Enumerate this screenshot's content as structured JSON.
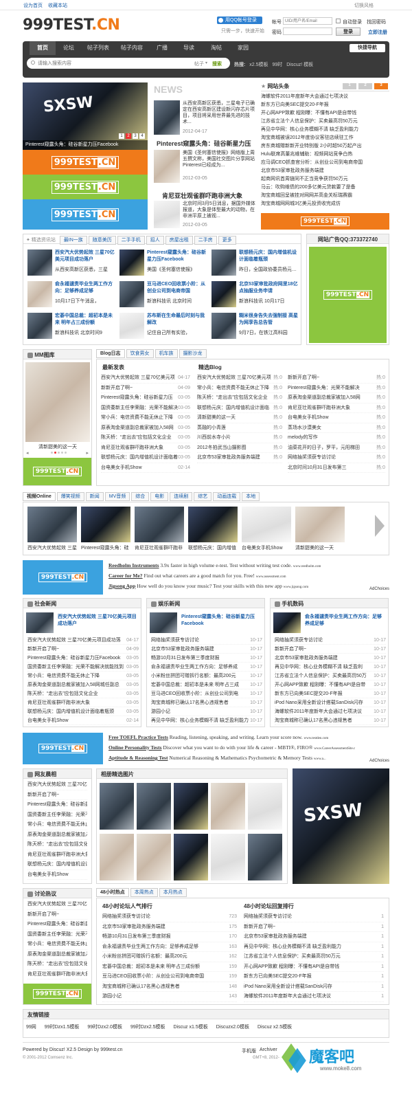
{
  "topbar": {
    "home": "设为首页",
    "fav": "收藏本站",
    "skin": "切换风格"
  },
  "logo": {
    "main": "999TEST",
    "ext": ".CN"
  },
  "qq": {
    "btn": "用QQ帐号登录",
    "sub": "只需一步，快速开始"
  },
  "login": {
    "user_label": "帐号",
    "user_ph": "UID/用户名/Email",
    "auto": "自动登录",
    "forgot": "找回密码",
    "pwd_label": "密码",
    "login_btn": "登录",
    "register": "立即注册"
  },
  "nav": [
    "首页",
    "论坛",
    "帖子列表",
    "帖子内容",
    "广播",
    "导读",
    "淘帖",
    "家园"
  ],
  "quicknav": "快捷导航",
  "search": {
    "placeholder": "请输入搜索内容",
    "scope": "帖子",
    "btn": "搜索",
    "hot_label": "热搜:",
    "hot": [
      "x2.5模板",
      "99时",
      "Discuz! 模板"
    ]
  },
  "slider": {
    "caption": "Pinterest窥露头角：硅谷新星力压Facebook",
    "pages": [
      "1",
      "2",
      "3",
      "4"
    ]
  },
  "news": {
    "label": "NEWS",
    "items": [
      {
        "intro": "从西安高新区获悉，三星电子已确定在西安高新区建设新闪存芯片项目，项目将采用世界最先进的技术...",
        "date": "2012-04-17",
        "title": "Pinterest窥露头角：硅谷新星力压"
      },
      {
        "intro": "美国《圣何塞信使报》网络版上周五撰文称，美国社交图片分享网站Pinterest已经成为...",
        "date": "2012-03-05",
        "title": "肯尼亚壮观雀群吓跑非洲大象"
      },
      {
        "intro": "北京时间3月5日消息，据国外媒体报道，大象是体型最大的动物，在非洲平原上被视...",
        "date": "2012-03-05"
      }
    ]
  },
  "headlines": {
    "title": "网站头条",
    "pages": [
      "1",
      "2",
      "3"
    ],
    "items": [
      "海螺软件2011年度新年大会通过七项决议",
      "新东方已向美SEC提交20-F年报",
      "开心网APP致歉 程刚曝：不懂有API是自带钱",
      "江苏省立法个人信息保护：买卖最高罚50万元",
      "再见中华网：核心业务模糊不清 缺乏盈利能力",
      "淘宝商城被误2012年度协议客驻店续驻工作",
      "房东商城赠新新开业特别版 2小时超50万起产出",
      "Hulu联席高董兆维辅助：视频网站竞争白热",
      "应马调CEO抓查官分析：从创业公司到电商帝国",
      "北京市53家审批政务服务端建",
      "起商网讯首周链同不正当竞争获罚50万元",
      "马云：吹购维债的200多亿美元贷款要了是备",
      "淘宝商城回呈被挂对网网并高金关标瑞赛霸",
      "淘宝商城网网城3亿美元投资收完成仿"
    ]
  },
  "tags": {
    "label": "精选资讯站",
    "items": [
      "最IN一族",
      "随意美历",
      "二手手机",
      "招人",
      "房屋出租",
      "二手房",
      "更多"
    ]
  },
  "news_grid": [
    {
      "title": "西安汽大优势起效 三星70亿美元项目成功落户",
      "desc": "从西安高新区获悉，三星"
    },
    {
      "title": "Pinterest窥露头角：硅谷新星力压Facebook",
      "desc": "美国《圣何塞信使报》"
    },
    {
      "title": "联想杨元庆：国内增值机设计面临着瓶颈",
      "desc": "昨日，全国政协委员杨元庆在"
    },
    {
      "title": "俞永福谴责毕业生两工作方向：足够养成足够",
      "desc": "10月17日下午消息，"
    },
    {
      "title": "豆马进CEO回收票小阶：从创业公司到电商帝国",
      "desc": "新浪科技讯 北京时间"
    },
    {
      "title": "北京53家审批政府网里18亿点抽服业务申请",
      "desc": "新浪科技讯 10月17日"
    },
    {
      "title": "宏碁中国总裁：超初本是未来 明年占三成份额",
      "desc": "新浪科技讯 北京时间9"
    },
    {
      "title": "苏布斯在生命最后时刻与我解改",
      "desc": "记住自己所有实验，"
    },
    {
      "title": "糊米很身告失去强制接 高星为网享告总告管",
      "desc": "9月7日，在铁江高科园"
    }
  ],
  "adqq": {
    "title": "网站广告QQ:373372740"
  },
  "mm": {
    "title": "MM图库",
    "caption": "清新甜美的这一天"
  },
  "blog": {
    "tabs": [
      "Blog日志",
      "饮食男女",
      "机车族",
      "摄影沙龙"
    ],
    "col1_title": "最新发表",
    "col2_title": "精选Blog",
    "col1": [
      [
        "西安汽大优势起效 三星70亿美元项",
        "04-17"
      ],
      [
        "新新开启了啊~",
        "04-09"
      ],
      [
        "Pinterest窥露头角：硅谷新星力压",
        "03-05"
      ],
      [
        "国资委新主任李荣融：光荣不能解决",
        "03-05"
      ],
      [
        "常小兵：电信资费不能无休止下降",
        "03-05"
      ],
      [
        "原表淘金渠道副总裁家被加入58网",
        "03-05"
      ],
      [
        "陈天桥：“走出去”应包括文化企业",
        "03-05"
      ],
      [
        "肯尼亚壮观雀群吓跑非洲大象",
        "03-05"
      ],
      [
        "联想杨元庆：国内增值机设计面临着",
        "03-05"
      ],
      [
        "台电美女手机Show",
        "02-14"
      ]
    ],
    "col2": [
      [
        "西安汽大优势起效 三星70亿美元项",
        "热:0"
      ],
      [
        "常小兵：电信资费不能无休止下降",
        "热:0"
      ],
      [
        "陈天桥：“走出去”应包括文化企业",
        "热:0"
      ],
      [
        "联想杨元庆：国内增值机设计面临",
        "热:0"
      ],
      [
        "清新甜美的这一天",
        "热:0"
      ],
      [
        "蒸融的小青莲",
        "热:0"
      ],
      [
        "川西前水寺小片",
        "热:0"
      ],
      [
        "2012冬拍武当山摄影图",
        "热:0"
      ],
      [
        "北京市53家审批政务服务端建",
        "热:0"
      ]
    ],
    "col3": [
      [
        "新新开启了啊~",
        "热:0"
      ],
      [
        "Pinterest窥露头角：光荣不能解决",
        "热:0"
      ],
      [
        "原表淘金渠道副总裁家被加入58网",
        "热:0"
      ],
      [
        "肯尼亚壮观雀群吓跑非洲大象",
        "热:0"
      ],
      [
        "台电美女手机Show",
        "热:0"
      ],
      [
        "蒸场水沙漠美女",
        "热:0"
      ],
      [
        "melody的写作",
        "热:0"
      ],
      [
        "油菜花开的日子，罗平，元阳梯田",
        "热:0"
      ],
      [
        "网络抽奖须获专访讨论",
        "热:0"
      ],
      [
        "北京时间10月31日发布第三",
        "热:0"
      ]
    ]
  },
  "video": {
    "tabs": [
      "视频Online",
      "爆笑视频",
      "新闻",
      "MV音频",
      "综合",
      "电影",
      "连续剧",
      "综艺",
      "动画连载",
      "本地"
    ],
    "items": [
      "西安汽大优势起效 三星",
      "Pinterest窥露头角：硅",
      "肯尼亚壮观雀群吓跑非",
      "联想杨元庆：国内增值",
      "台电美女手机Show",
      "清新甜美的这一天"
    ]
  },
  "textad1": [
    {
      "title": "Reedholm Instruments",
      "text": "3.9x faster in high volume e-test. Test without writing test code.",
      "url": "www.reedholm.com"
    },
    {
      "title": "Career for Me?",
      "text": "Find out what careers are a good match for you. Free!",
      "url": "www.assessment.com"
    },
    {
      "title": "Jigsong App",
      "text": "How well do you know your music? Test your skills with this new app",
      "url": "www.jigsong.com"
    }
  ],
  "adchoices": "AdChoices",
  "cols3": [
    {
      "title": "社会新闻",
      "lead": "西安汽大优势起效 三星70亿美元项目成功落户",
      "items": [
        [
          "西安汽大优势起效 三星70亿美元项目成功落",
          "04-17"
        ],
        [
          "新新开启了啊~",
          "04-09"
        ],
        [
          "Pinterest窥露头角：硅谷新星力压Facebook",
          "03-05"
        ],
        [
          "国资委新主任李荣融：光荣不能解决就能找到",
          "03-05"
        ],
        [
          "常小兵：电信资费不能无休止下降",
          "03-05"
        ],
        [
          "原表淘金渠道副总裁家被加入58网城任副总",
          "03-05"
        ],
        [
          "陈天桥：“走出去”应包括文化企业",
          "03-05"
        ],
        [
          "肯尼亚壮观雀群吓跑非洲大象",
          "03-05"
        ],
        [
          "联想杨元庆：国内增值机设计面临着瓶颈",
          "03-05"
        ],
        [
          "台电美女手机Show",
          "02-14"
        ]
      ]
    },
    {
      "title": "娱乐新闻",
      "lead": "Pinterest窥露头角：硅谷新星力压Facebook",
      "items": [
        [
          "网络抽奖须获专访讨论",
          "10-17"
        ],
        [
          "北京市53家审批政务服务端建",
          "10-17"
        ],
        [
          "畅游10月31日发布第三季度财报",
          "10-17"
        ],
        [
          "俞永福谴责毕业生两工作方向：足够养成",
          "10-17"
        ],
        [
          "小米粉丝拼团可赠拆行名额：最高200元",
          "10-17"
        ],
        [
          "宏碁中国总裁：超初本是未来 明年占三成",
          "10-17"
        ],
        [
          "豆马进CEO回收票小阶：从创业公司到电",
          "10-17"
        ],
        [
          "淘宝商城称已确认17名黑心违规售者",
          "10-17"
        ],
        [
          "游园小记",
          "10-17"
        ],
        [
          "再见中华网：核心业务模糊不清 缺乏盈利能力",
          "10-17"
        ]
      ]
    },
    {
      "title": "手机数码",
      "lead": "俞永福谴责毕业生两工作方向：足够养成足够",
      "items": [
        [
          "网络抽奖须获专访讨论",
          "10-17"
        ],
        [
          "新新开启了啊~",
          "10-17"
        ],
        [
          "北京市53家审批政务服务端建",
          "10-17"
        ],
        [
          "再见中华网：核心业务模糊不清 缺乏盈利",
          "10-17"
        ],
        [
          "江苏省立法个人信息保护：买卖最高罚50万",
          "10-17"
        ],
        [
          "开心网APP致歉 程刚曝：不懂有API是自带",
          "10-17"
        ],
        [
          "新东方已向美SEC提交20-F年报",
          "10-17"
        ],
        [
          "iPod Nano采用全新设计搭载SanDisk闪存",
          "10-17"
        ],
        [
          "海螺软件2011年度新年大会通过七项决议",
          "10-17"
        ],
        [
          "淘宝商城称已确认17名黑心违规售者",
          "10-17"
        ]
      ]
    }
  ],
  "textad2": [
    {
      "title": "Free TOEFL Practice Tests",
      "text": "Reading, listening, speaking, and writing. Learn your score now.",
      "url": "www.testden.com"
    },
    {
      "title": "Online Personality Tests",
      "text": "Discover what you want to do with your life & career - MBTI®, FIRO®",
      "url": "www.CareerAssessmentSite.c"
    },
    {
      "title": "Aptitude & Reasoning Test",
      "text": "Numerical Reasoning & Mathematics Psychometric & Memory Tests",
      "url": "www.a..."
    }
  ],
  "friends": {
    "title": "网友晨相",
    "items": [
      "西安汽大优势起效 三星70亿美",
      "新新开启了啊~",
      "Pinterest窥露头角：硅谷新星力",
      "国资委新主任李荣融：光荣不能",
      "常小兵：电信资费不能无休止下",
      "原表淘金渠道副总裁家被加入58",
      "陈天桥：“走出去”应包括文化企",
      "肯尼亚壮观雀群吓跑非洲大象",
      "联想杨元庆：国内增值机设计面",
      "台电美女手机Show"
    ]
  },
  "album": {
    "title": "相册精选图片"
  },
  "discuss": {
    "title": "讨论热议",
    "items": [
      "西安汽大优势起效 三星70亿美",
      "新新开启了啊~",
      "Pinterest窥露头角：硅谷新星力",
      "国资委新主任李荣融：光荣不能",
      "常小兵：电信资费不能无休止下",
      "原表淘金渠道副总裁家被加入58",
      "陈天桥：“走出去”应包括文化企",
      "肯尼亚壮观雀群吓跑非洲大象"
    ]
  },
  "hot": {
    "tabs": [
      "48小时热点",
      "本周热点",
      "本月热点"
    ],
    "col1_title": "48小时论坛人气排行",
    "col2_title": "48小时论坛回复排行",
    "col1": [
      [
        "网络抽奖须获专访讨论",
        "723"
      ],
      [
        "北京市53家审批政务服务端建",
        "175"
      ],
      [
        "畅游10月31日发布第三季度财报",
        "170"
      ],
      [
        "俞永福谴责毕业生两工作方向：足够养成足够",
        "163"
      ],
      [
        "小米粉丝拼团可赠拆行名额：最高200元",
        "162"
      ],
      [
        "宏碁中国总裁：超初本是未来 明年占三成份额",
        "159"
      ],
      [
        "豆马进CEO回收票小阶：从创业公司到电商帝国",
        "159"
      ],
      [
        "淘宝商城称已确认17名黑心违规售者",
        "148"
      ],
      [
        "游园小记",
        "143"
      ]
    ],
    "col2": [
      [
        "网络抽奖须获专访讨论",
        "1"
      ],
      [
        "新新开启了啊~",
        "1"
      ],
      [
        "北京市53家审批政务服务端建",
        "1"
      ],
      [
        "再见中华网：核心业务模糊不清 缺乏盈利能力",
        "1"
      ],
      [
        "江苏省立法个人信息保护：买卖最高罚50万元",
        "1"
      ],
      [
        "开心网APP致歉 程刚曝：不懂有API是自带钱",
        "1"
      ],
      [
        "新东方已向美SEC提交20-F年报",
        "1"
      ],
      [
        "iPod Nano采用全新设计搭载SanDisk闪存",
        "1"
      ],
      [
        "海螺软件2011年度新年大会通过七项决议",
        "1"
      ]
    ]
  },
  "links": {
    "title": "友情链接",
    "items": [
      "99网",
      "99时Dzx1.5模板",
      "99时Dzx2.0模板",
      "99时Dzx2.5模板",
      "Discuz x1.5模板",
      "Discuzx2.0模板",
      "Discuz x2.5模板"
    ]
  },
  "footer": {
    "powered": "Powered by Discuz! X2.5 Design by 999test.cn",
    "copy": "© 2001-2012 Comsenz Inc.",
    "mobile": "手机版",
    "archiver": "Archiver",
    "gmt": "GMT+8, 2012-"
  },
  "watermark": {
    "brand": "魔客吧",
    "url": "www.moke8.com"
  },
  "colors": {
    "orange": "#f07a1a",
    "green": "#8cc63f",
    "blue": "#3ba2df",
    "navbar": "#3a3a3a"
  }
}
